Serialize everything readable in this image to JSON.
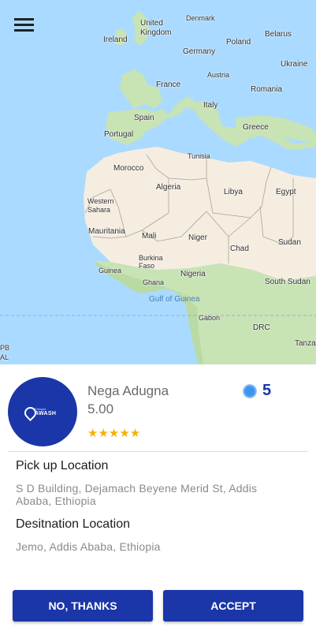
{
  "map": {
    "labels": {
      "united_kingdom": "United\nKingdom",
      "denmark": "Denmark",
      "belarus": "Belarus",
      "ireland": "Ireland",
      "poland": "Poland",
      "germany": "Germany",
      "ukraine": "Ukraine",
      "austria": "Austria",
      "france": "France",
      "romania": "Romania",
      "italy": "Italy",
      "spain": "Spain",
      "greece": "Greece",
      "portugal": "Portugal",
      "tunisia": "Tunisia",
      "morocco": "Morocco",
      "algeria": "Algeria",
      "libya": "Libya",
      "egypt": "Egypt",
      "western_sahara": "Western\nSahara",
      "mauritania": "Mauritania",
      "mali": "Mali",
      "niger": "Niger",
      "chad": "Chad",
      "sudan": "Sudan",
      "burkina_faso": "Burkina\nFaso",
      "guinea": "Guinea",
      "ghana": "Ghana",
      "nigeria": "Nigeria",
      "south_sudan": "South Sudan",
      "gulf_of_guinea": "Gulf of Guinea",
      "gabon": "Gabon",
      "drc": "DRC",
      "tanzania": "Tanza",
      "pb": "PB",
      "al": "AL"
    }
  },
  "driver": {
    "avatar_brand_small": "Ethiopia",
    "avatar_brand": "AWASH",
    "name": "Nega Adugna",
    "rating": "5.00",
    "stars": "★★★★★",
    "seat_count": "5"
  },
  "pickup": {
    "title": "Pick up Location",
    "address": "S D Building, Dejamach Beyene Merid St, Addis Ababa, Ethiopia"
  },
  "destination": {
    "title": "Desitnation Location",
    "address": "Jemo, Addis Ababa, Ethiopia"
  },
  "actions": {
    "decline_label": "NO, THANKS",
    "accept_label": "ACCEPT"
  },
  "colors": {
    "brand_blue": "#1a36a8",
    "star_gold": "#f5b10a",
    "sea": "#aadaff",
    "land_green": "#c8e3b4",
    "desert": "#f6ede1"
  }
}
